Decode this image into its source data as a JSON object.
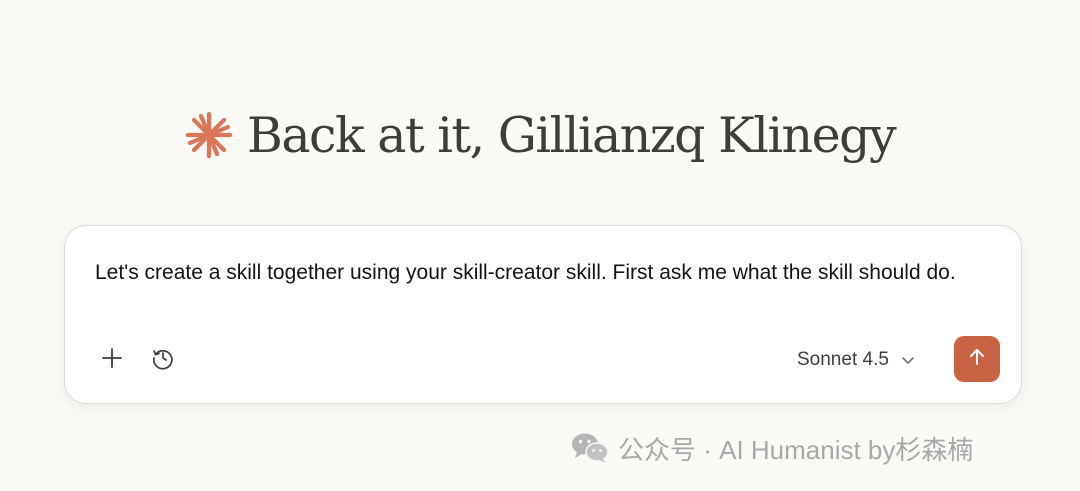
{
  "greeting": {
    "title": "Back at it, Gillianzq Klinegy"
  },
  "composer": {
    "prompt_text": "Let's create a skill together using your skill-creator skill. First ask me what the skill should do.",
    "model_label": "Sonnet 4.5"
  },
  "icons": {
    "logo": "claude-starburst-icon",
    "add": "plus-icon",
    "history": "clock-history-icon",
    "chevron": "chevron-down-icon",
    "send": "arrow-up-icon",
    "watermark": "wechat-icon"
  },
  "colors": {
    "background": "#faf9f5",
    "accent": "#c96442",
    "logo": "#d97757",
    "text": "#3d3d3a"
  },
  "watermark": {
    "text": "公众号 · AI Humanist by杉森楠"
  }
}
